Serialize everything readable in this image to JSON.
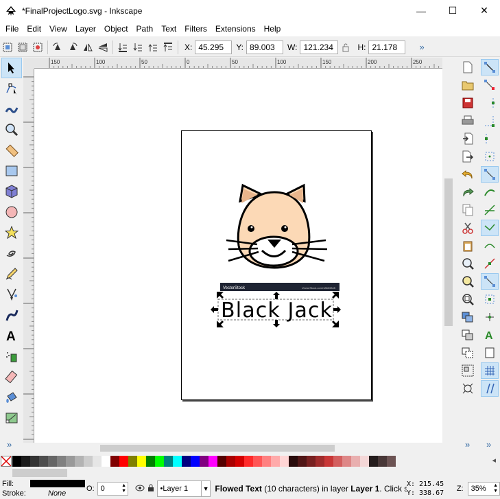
{
  "window": {
    "title": "*FinalProjectLogo.svg - Inkscape",
    "minimize": "—",
    "maximize": "☐",
    "close": "✕"
  },
  "menu": [
    {
      "label": "File"
    },
    {
      "label": "Edit"
    },
    {
      "label": "View"
    },
    {
      "label": "Layer"
    },
    {
      "label": "Object"
    },
    {
      "label": "Path"
    },
    {
      "label": "Text"
    },
    {
      "label": "Filters"
    },
    {
      "label": "Extensions"
    },
    {
      "label": "Help"
    }
  ],
  "controls": {
    "x_label": "X:",
    "x_value": "45.295",
    "y_label": "Y:",
    "y_value": "89.003",
    "w_label": "W:",
    "w_value": "121.234",
    "h_label": "H:",
    "h_value": "21.178",
    "overflow": "»"
  },
  "ruler": {
    "h_ticks": [
      "150",
      "100",
      "50",
      "0",
      "50",
      "100",
      "150",
      "200",
      "250",
      "300"
    ]
  },
  "canvas": {
    "banner_left": "VectorStock",
    "banner_right": "VectorStock.com/18633345",
    "text_object": "Black Jack"
  },
  "palette_colors": [
    "#000000",
    "#1a1a1a",
    "#333333",
    "#4d4d4d",
    "#666666",
    "#808080",
    "#999999",
    "#b3b3b3",
    "#cccccc",
    "#e6e6e6",
    "#ffffff",
    "#800000",
    "#ff0000",
    "#808000",
    "#ffff00",
    "#008000",
    "#00ff00",
    "#008080",
    "#00ffff",
    "#000080",
    "#0000ff",
    "#800080",
    "#ff00ff",
    "#550000",
    "#aa0000",
    "#d40000",
    "#ff2a2a",
    "#ff5555",
    "#ff8080",
    "#ffaaaa",
    "#ffd5d5",
    "#280b0b",
    "#501616",
    "#782121",
    "#a02c2c",
    "#c83737",
    "#d35f5f",
    "#de8787",
    "#e9afaf",
    "#f4d7d7",
    "#241c1c",
    "#483737",
    "#6c5353"
  ],
  "status": {
    "fill_label": "Fill:",
    "stroke_label": "Stroke:",
    "stroke_value": "None",
    "opacity_label": "O:",
    "opacity_value": "0",
    "layer": "•Layer 1",
    "message_type": "Flowed Text",
    "message_rest": " (10 characters) in layer ",
    "message_layer": "Layer 1",
    "message_tail": ". Click s...",
    "x_label": "X:",
    "x_value": "215.45",
    "y_label": "Y:",
    "y_value": "338.67",
    "zoom_label": "Z:",
    "zoom_value": "35%"
  },
  "colors": {
    "cat_fill": "#fcd9b6",
    "selection_handle": "#000000",
    "active_tool_bg": "#cce4f7"
  }
}
